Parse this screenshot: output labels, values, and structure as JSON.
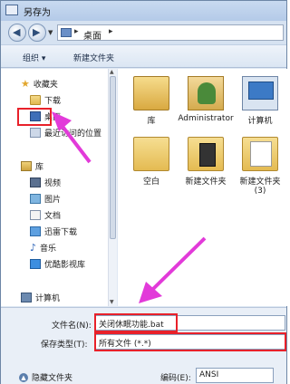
{
  "window": {
    "title": "另存为"
  },
  "address": {
    "location": "桌面",
    "separator": "▸",
    "sep_arrow": "▸"
  },
  "toolbar": {
    "organize": "组织 ▾",
    "new_folder": "新建文件夹"
  },
  "nav_pane": {
    "items": [
      {
        "label": "收藏夹",
        "icon": "star-icon"
      },
      {
        "label": "下载",
        "icon": "download-folder-icon"
      },
      {
        "label": "桌面",
        "icon": "desktop-icon",
        "highlighted": true
      },
      {
        "label": "最近访问的位置",
        "icon": "recent-places-icon"
      },
      {
        "label": "库",
        "icon": "library-icon"
      },
      {
        "label": "视频",
        "icon": "video-icon"
      },
      {
        "label": "图片",
        "icon": "picture-icon"
      },
      {
        "label": "文档",
        "icon": "document-icon"
      },
      {
        "label": "迅雷下载",
        "icon": "thunder-download-icon"
      },
      {
        "label": "音乐",
        "icon": "music-icon"
      },
      {
        "label": "优酷影视库",
        "icon": "youku-icon"
      },
      {
        "label": "计算机",
        "icon": "computer-icon"
      }
    ]
  },
  "files": [
    {
      "label": "库",
      "icon": "library-icon"
    },
    {
      "label": "Administrator",
      "icon": "user-folder-icon"
    },
    {
      "label": "计算机",
      "icon": "computer-icon"
    },
    {
      "label": "空白",
      "icon": "folder-icon"
    },
    {
      "label": "新建文件夹",
      "icon": "folder-icon"
    },
    {
      "label": "新建文件夹\n(3)",
      "icon": "folder-icon"
    }
  ],
  "form": {
    "filename_label": "文件名(N):",
    "filename_value": "关闭休眠功能.bat",
    "filetype_label": "保存类型(T):",
    "filetype_value": "所有文件 (*.*)",
    "hide_folders": "隐藏文件夹",
    "encoding_label": "编码(E):",
    "encoding_value": "ANSI"
  },
  "colors": {
    "highlight": "#e8212a",
    "annotation_arrow": "#e23ad9"
  }
}
